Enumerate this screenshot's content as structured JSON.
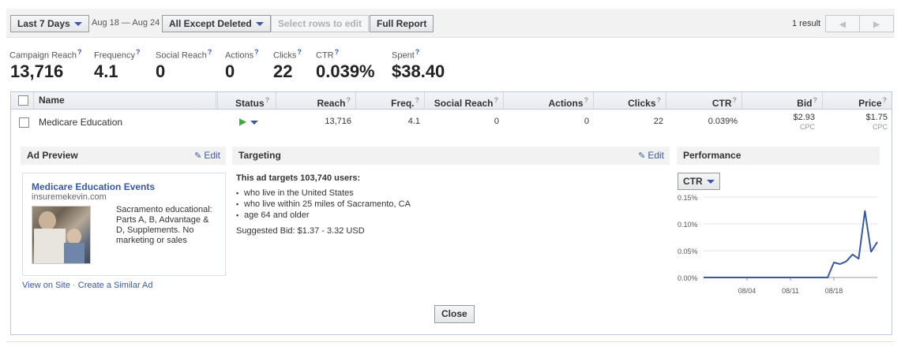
{
  "toolbar": {
    "date_range_label": "Last 7 Days",
    "date_range_text": "Aug 18 — Aug 24",
    "filter_label": "All Except Deleted",
    "select_rows_label": "Select rows to edit",
    "full_report_label": "Full Report",
    "result_count": "1 result"
  },
  "summary": [
    {
      "label": "Campaign Reach",
      "value": "13,716"
    },
    {
      "label": "Frequency",
      "value": "4.1"
    },
    {
      "label": "Social Reach",
      "value": "0"
    },
    {
      "label": "Actions",
      "value": "0"
    },
    {
      "label": "Clicks",
      "value": "22"
    },
    {
      "label": "CTR",
      "value": "0.039%"
    },
    {
      "label": "Spent",
      "value": "$38.40"
    }
  ],
  "table": {
    "headers": {
      "name": "Name",
      "status": "Status",
      "reach": "Reach",
      "freq": "Freq.",
      "social_reach": "Social Reach",
      "actions": "Actions",
      "clicks": "Clicks",
      "ctr": "CTR",
      "bid": "Bid",
      "price": "Price"
    },
    "row": {
      "name": "Medicare Education",
      "reach": "13,716",
      "freq": "4.1",
      "social_reach": "0",
      "actions": "0",
      "clicks": "22",
      "ctr": "0.039%",
      "bid": "$2.93",
      "bid_unit": "CPC",
      "price": "$1.75",
      "price_unit": "CPC"
    }
  },
  "ad_preview": {
    "header": "Ad Preview",
    "edit_label": "Edit",
    "ad_title": "Medicare Education Events",
    "ad_url": "insuremekevin.com",
    "ad_body": "Sacramento educational: Parts A, B, Advantage & D, Supplements. No marketing or sales",
    "view_on_site": "View on Site",
    "separator": "·",
    "create_similar": "Create a Similar Ad"
  },
  "targeting": {
    "header": "Targeting",
    "edit_label": "Edit",
    "summary": "This ad targets 103,740 users:",
    "items": [
      "who live in the United States",
      "who live within 25 miles of Sacramento, CA",
      "age 64 and older"
    ],
    "suggested_bid": "Suggested Bid: $1.37 - 3.32 USD"
  },
  "performance": {
    "header": "Performance",
    "metric_label": "CTR"
  },
  "close_label": "Close",
  "chart_data": {
    "type": "line",
    "title": "",
    "xlabel": "",
    "ylabel": "",
    "ylim": [
      0,
      0.15
    ],
    "y_ticks": [
      "0.00%",
      "0.05%",
      "0.10%",
      "0.15%"
    ],
    "x_tick_labels": [
      "08/04",
      "08/11",
      "08/18"
    ],
    "x": [
      "07/28",
      "07/29",
      "07/30",
      "07/31",
      "08/01",
      "08/02",
      "08/03",
      "08/04",
      "08/05",
      "08/06",
      "08/07",
      "08/08",
      "08/09",
      "08/10",
      "08/11",
      "08/12",
      "08/13",
      "08/14",
      "08/15",
      "08/16",
      "08/17",
      "08/18",
      "08/19",
      "08/20",
      "08/21",
      "08/22",
      "08/23",
      "08/24"
    ],
    "values": [
      0,
      0,
      0,
      0,
      0,
      0,
      0,
      0,
      0,
      0,
      0,
      0,
      0,
      0,
      0,
      0,
      0,
      0,
      0,
      0,
      0,
      0.028,
      0.025,
      0.03,
      0.043,
      0.035,
      0.124,
      0.048,
      0.066
    ],
    "grid": true,
    "line_color": "#3b5998"
  }
}
